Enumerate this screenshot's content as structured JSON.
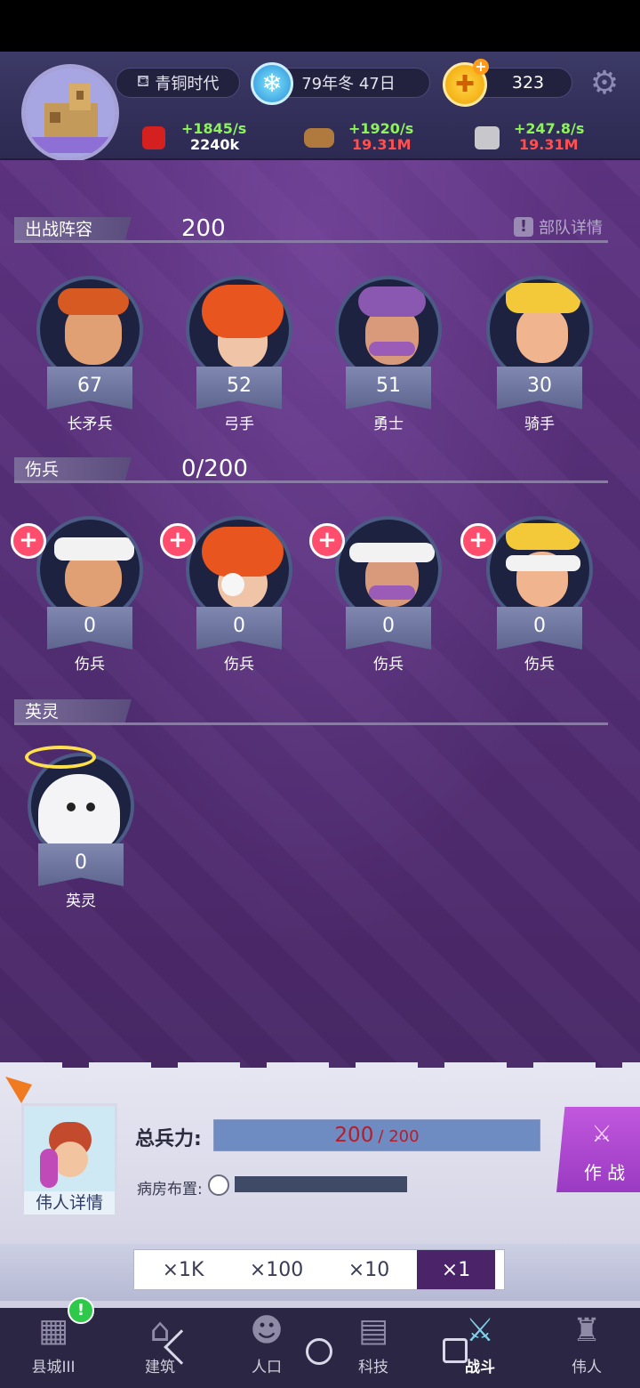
{
  "header": {
    "era": "青铜时代",
    "date": "79年冬 47日",
    "coins": "323",
    "resources": [
      {
        "rate": "+1845/s",
        "amount": "2240k",
        "amount_color": "white",
        "icon": "meat-icon"
      },
      {
        "rate": "+1920/s",
        "amount": "19.31M",
        "amount_color": "red",
        "icon": "wood-icon"
      },
      {
        "rate": "+247.8/s",
        "amount": "19.31M",
        "amount_color": "red",
        "icon": "stone-icon"
      }
    ]
  },
  "deploy": {
    "label": "出战阵容",
    "count": "200",
    "details_label": "部队详情",
    "units": [
      {
        "value": "67",
        "name": "长矛兵"
      },
      {
        "value": "52",
        "name": "弓手"
      },
      {
        "value": "51",
        "name": "勇士"
      },
      {
        "value": "30",
        "name": "骑手"
      }
    ]
  },
  "wounded": {
    "label": "伤兵",
    "count": "0/200",
    "units": [
      {
        "value": "0",
        "name": "伤兵"
      },
      {
        "value": "0",
        "name": "伤兵"
      },
      {
        "value": "0",
        "name": "伤兵"
      },
      {
        "value": "0",
        "name": "伤兵"
      }
    ]
  },
  "spirits": {
    "label": "英灵",
    "unit": {
      "value": "0",
      "name": "英灵"
    }
  },
  "bottom": {
    "hero_label": "伟人详情",
    "total_label": "总兵力:",
    "total_current": "200",
    "total_max": "/ 200",
    "total_fraction": 1.0,
    "ward_label": "病房布置:",
    "fight_label": "作 战",
    "multipliers": [
      "×1K",
      "×100",
      "×10",
      "×1"
    ],
    "selected_multiplier": "×1"
  },
  "nav": [
    {
      "label": "县城III",
      "icon": "city-icon"
    },
    {
      "label": "建筑",
      "icon": "building-icon"
    },
    {
      "label": "人口",
      "icon": "population-icon"
    },
    {
      "label": "科技",
      "icon": "tech-book-icon"
    },
    {
      "label": "战斗",
      "icon": "battle-swords-icon"
    },
    {
      "label": "伟人",
      "icon": "great-person-icon"
    }
  ],
  "colors": {
    "background": "#5a2f78",
    "rate_green": "#8ef25c",
    "amount_red": "#ff5050",
    "fight_button": "#b04ad0",
    "selected_multiplier": "#4a2368"
  }
}
